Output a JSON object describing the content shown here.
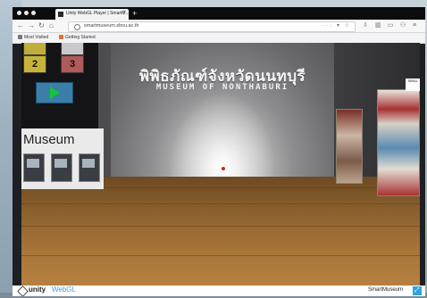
{
  "browser": {
    "tab": {
      "title": "Unity WebGL Player | SmartM..."
    },
    "address": {
      "url": "smartmuseum.sbsu.ac.th"
    },
    "bookmarks": [
      {
        "label": "Most Visited",
        "icon": "gear-icon"
      },
      {
        "label": "Getting Started",
        "icon": "firefox-icon"
      }
    ]
  },
  "game": {
    "keypad": {
      "keys": [
        "2",
        "3"
      ]
    },
    "sign_thai": "พิพิธภัณฑ์จังหวัดนนทบุรี",
    "sign_english": "MUSEUM OF NONTHABURI",
    "left_panel_word": "Museum",
    "corner_logo_text": "SBSU"
  },
  "footer": {
    "brand": "unity",
    "brand_suffix": "WebGL",
    "title": "SmartMuseum"
  }
}
